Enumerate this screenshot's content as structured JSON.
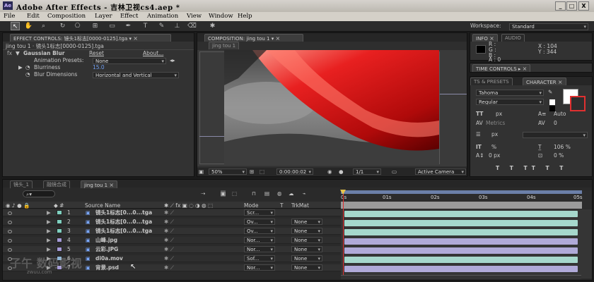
{
  "window": {
    "title": "Adobe After Effects - 吉林卫视cs4.aep *",
    "app_badge": "Ae",
    "min": "_",
    "max": "□",
    "close": "X"
  },
  "menu": [
    "File",
    "Edit",
    "Composition",
    "Layer",
    "Effect",
    "Animation",
    "View",
    "Window",
    "Help"
  ],
  "workspace": {
    "label": "Workspace:",
    "value": "Standard"
  },
  "effect_controls": {
    "tab": "EFFECT CONTROLS: 镜头1标志[0000-0125].tga",
    "header": "jing tou 1 · 镜头1标志[0000-0125].tga",
    "fx": "fx",
    "effect_name": "Gaussian Blur",
    "reset": "Reset",
    "about": "About...",
    "anim_presets_label": "Animation Presets:",
    "anim_presets_value": "None",
    "blurriness_label": "Blurriness",
    "blurriness_value": "15.0",
    "blur_dim_label": "Blur Dimensions",
    "blur_dim_value": "Horizontal and Vertical"
  },
  "composition": {
    "tab": "COMPOSITION: jing tou 1",
    "subtab": "jing tou 1",
    "zoom": "50%",
    "timecode": "0:00:00:02",
    "resolution": "1/1",
    "camera": "Active Camera"
  },
  "info": {
    "tab1": "INFO",
    "tab2": "AUDIO",
    "r": "R :",
    "g": "G :",
    "b": "B :",
    "a": "A : 0",
    "x": "X : 104",
    "y": "Y : 344"
  },
  "time_controls": {
    "tab": "TIME CONTROLS"
  },
  "character": {
    "tab1": "TS & PRESETS",
    "tab2": "CHARACTER",
    "font": "Tahoma",
    "style": "Regular",
    "size": "px",
    "leading": "Auto",
    "kerning": "Metrics",
    "tracking": "0",
    "stroke": "px",
    "vscale": "%",
    "hscale": "106 %",
    "baseline": "0 px",
    "tsume": "0 %"
  },
  "timeline": {
    "tabs": [
      "镜头_1",
      "融镜合成",
      "jing tou 1"
    ],
    "search_placeholder": "",
    "col_source": "Source Name",
    "col_mode": "Mode",
    "col_t": "T",
    "col_trkmat": "TrkMat",
    "ruler": [
      "0s",
      "01s",
      "02s",
      "03s",
      "04s",
      "05s"
    ],
    "layers": [
      {
        "num": "1",
        "name": "镜头1标志[0...0...tga",
        "mode": "Scr...",
        "trkmat": "",
        "color": "#7fd0c0",
        "bar": "#a6d8cc"
      },
      {
        "num": "2",
        "name": "镜头1标志[0...0...tga",
        "mode": "Ov...",
        "trkmat": "None",
        "color": "#7fd0c0",
        "bar": "#a6d8cc"
      },
      {
        "num": "3",
        "name": "镜头1标志[0...0...tga",
        "mode": "Ov...",
        "trkmat": "None",
        "color": "#7fd0c0",
        "bar": "#a6d8cc"
      },
      {
        "num": "4",
        "name": "山峰.jpg",
        "mode": "Nor...",
        "trkmat": "None",
        "color": "#a59ad8",
        "bar": "#b0aad8"
      },
      {
        "num": "5",
        "name": "云彩.JPG",
        "mode": "Nor...",
        "trkmat": "None",
        "color": "#a59ad8",
        "bar": "#b0aad8"
      },
      {
        "num": "6",
        "name": "di0a.mov",
        "mode": "Sof...",
        "trkmat": "None",
        "color": "#8fb7d8",
        "bar": "#a6d8cc"
      },
      {
        "num": "7",
        "name": "背景.psd",
        "mode": "Nor...",
        "trkmat": "None",
        "color": "#a59ad8",
        "bar": "#b0aad8"
      }
    ]
  },
  "watermark": {
    "text": "子午 数码影视",
    "url": "zwuu.com"
  },
  "colors": {
    "accent": "#6f9df0",
    "playhead": "#e03030"
  }
}
